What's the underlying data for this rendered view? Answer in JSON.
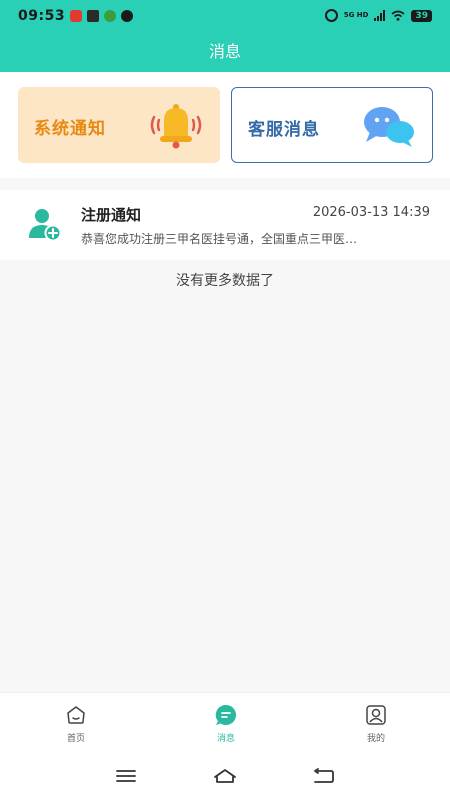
{
  "status_bar": {
    "time": "09:53",
    "network": "5G HD",
    "battery": "39"
  },
  "header": {
    "title": "消息"
  },
  "cards": {
    "system": {
      "label": "系统通知",
      "icon": "bell-icon",
      "color": "#e78a12",
      "bg": "#fde6c6"
    },
    "service": {
      "label": "客服消息",
      "icon": "chat-bubbles-icon",
      "color": "#356aa8"
    }
  },
  "messages": [
    {
      "title": "注册通知",
      "time": "2026-03-13 14:39",
      "preview": "恭喜您成功注册三甲名医挂号通，全国重点三甲医…",
      "icon": "user-add-icon"
    }
  ],
  "list_footer": "没有更多数据了",
  "tabbar": {
    "active": "消息",
    "accent": "#2ab89f",
    "items": [
      {
        "label": "首页",
        "icon": "home-icon"
      },
      {
        "label": "消息",
        "icon": "message-icon"
      },
      {
        "label": "我的",
        "icon": "profile-icon"
      }
    ]
  },
  "colors": {
    "header": "#2ad0b5",
    "background": "#f7f7f7"
  }
}
